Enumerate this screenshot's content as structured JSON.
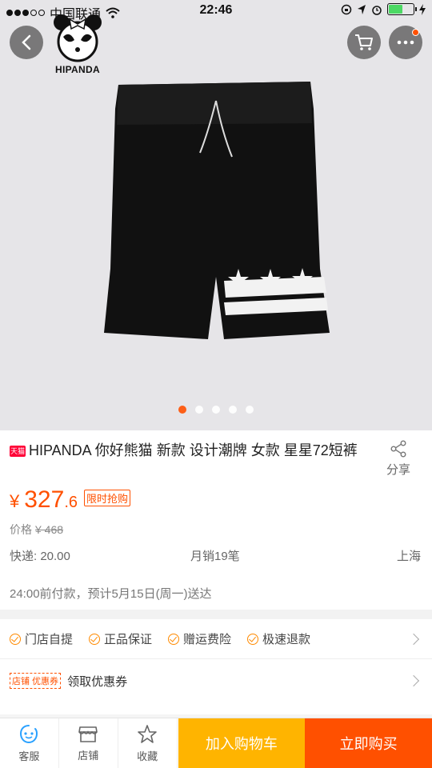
{
  "status_bar": {
    "carrier": "中国联通",
    "time": "22:46"
  },
  "gallery": {
    "brand": "HIPANDA",
    "slide_count": 5,
    "active_slide": 0
  },
  "product": {
    "badge": "天猫",
    "title": "HIPANDA 你好熊猫 新款 设计潮牌 女款 星星72短裤",
    "share_label": "分享",
    "price_currency": "¥",
    "price_int": "327",
    "price_dec": ".6",
    "limit_tag": "限时抢购",
    "orig_label": "价格",
    "orig_price": "¥ 468",
    "shipping": "快递: 20.00",
    "monthly_sales": "月销19笔",
    "location": "上海",
    "delivery_note": "24:00前付款，预计5月15日(周一)送达"
  },
  "guarantees": [
    "门店自提",
    "正品保证",
    "赠运费险",
    "极速退款"
  ],
  "coupon": {
    "tag": "店铺 优惠券",
    "text": "领取优惠券"
  },
  "bottom_bar": {
    "service": "客服",
    "shop": "店铺",
    "favorite": "收藏",
    "add_cart": "加入购物车",
    "buy_now": "立即购买"
  },
  "colors": {
    "accent": "#ff5000",
    "cart_button": "#ffb400",
    "battery": "#4cd964"
  }
}
